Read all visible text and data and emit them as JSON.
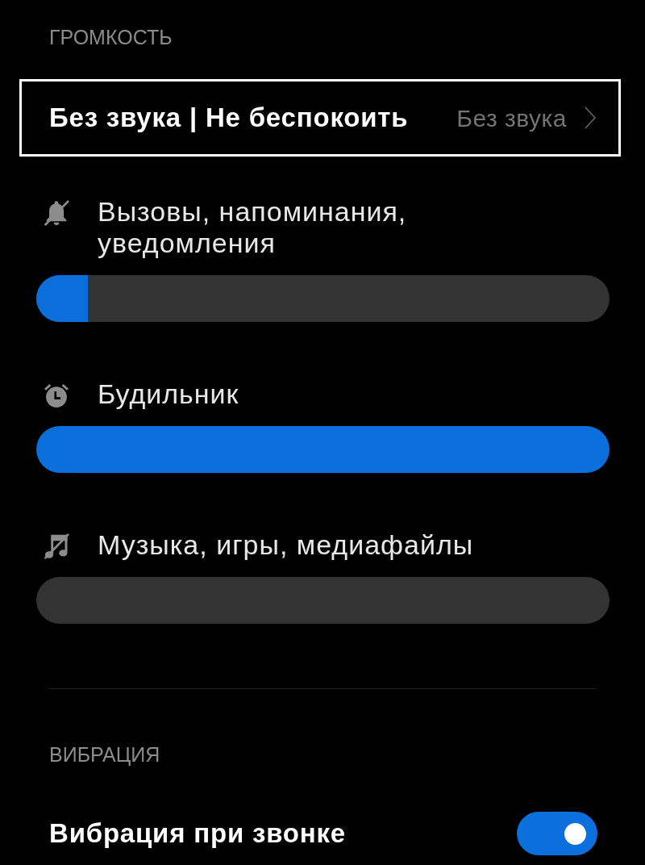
{
  "volume_section": {
    "header": "ГРОМКОСТЬ",
    "mode_row": {
      "label": "Без звука | Не беспокоить",
      "value": "Без звука",
      "focused": true
    },
    "sliders": [
      {
        "kind": "ringer",
        "label": "Вызовы, напоминания, уведомления",
        "muted": true,
        "level": 0.09
      },
      {
        "kind": "alarm",
        "label": "Будильник",
        "muted": false,
        "level": 1
      },
      {
        "kind": "media",
        "label": "Музыка, игры, медиафайлы",
        "muted": true,
        "level": 0
      }
    ]
  },
  "vibration_section": {
    "header": "ВИБРАЦИЯ",
    "toggles": [
      {
        "label": "Вибрация при звонке",
        "on": true
      }
    ]
  }
}
